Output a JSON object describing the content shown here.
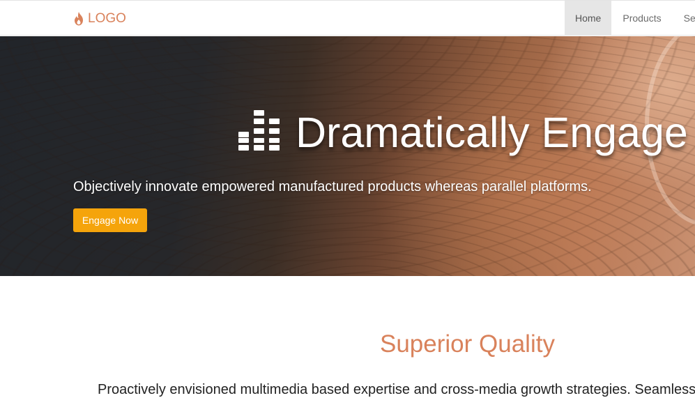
{
  "header": {
    "logo_text": "LOGO",
    "nav": [
      {
        "label": "Home",
        "active": true
      },
      {
        "label": "Products",
        "active": false
      },
      {
        "label": "Services",
        "active": false
      }
    ]
  },
  "hero": {
    "icon": "equalizer-icon",
    "title": "Dramatically Engage",
    "subtitle": "Objectively innovate empowered manufactured products whereas parallel platforms.",
    "cta_label": "Engage Now"
  },
  "section": {
    "title": "Superior Quality",
    "text": "Proactively envisioned multimedia based expertise and cross-media growth strategies. Seamlessly"
  },
  "colors": {
    "accent": "#d9825b",
    "cta": "#f5a40b",
    "nav_active_bg": "#e6e6e6"
  }
}
